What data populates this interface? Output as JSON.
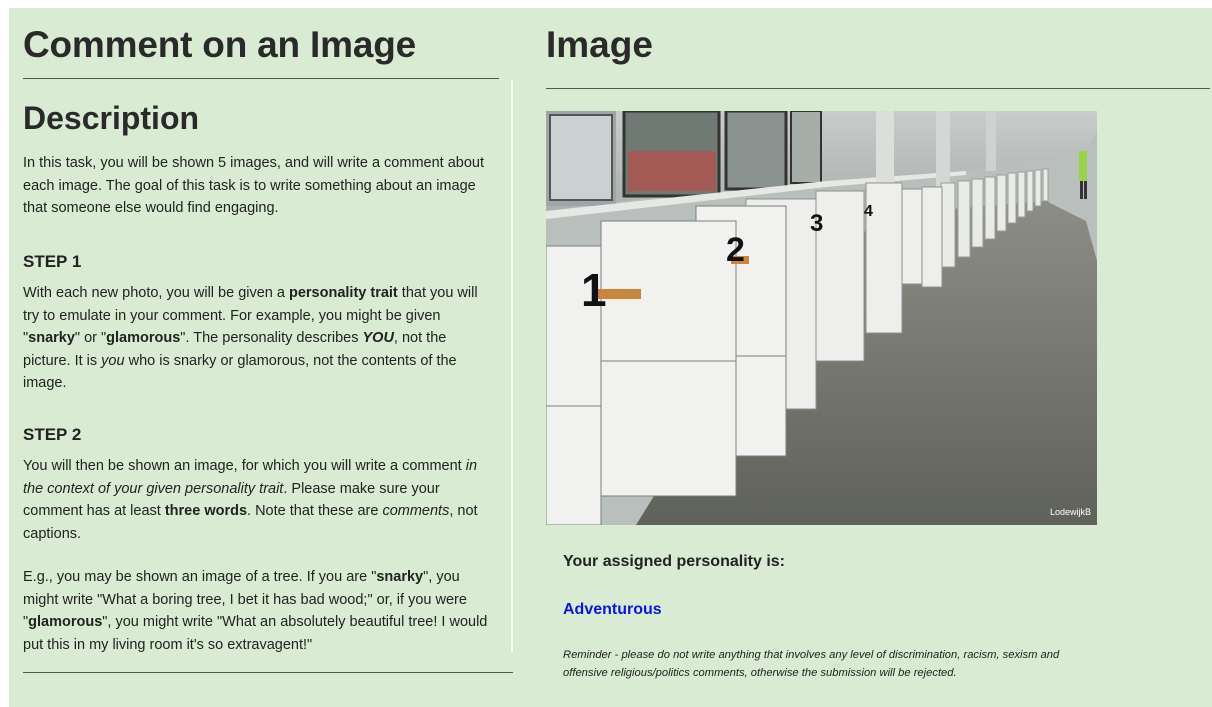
{
  "left": {
    "title": "Comment on an Image",
    "description_heading": "Description",
    "intro": "In this task, you will be shown 5 images, and will write a comment about each image. The goal of this task is to write something about an image that someone else would find engaging.",
    "step1": {
      "heading": "STEP 1",
      "t1": "With each new photo, you will be given a ",
      "b1": "personality trait",
      "t2": " that you will try to emulate in your comment. For example, you might be given \"",
      "b2": "snarky",
      "t3": "\" or \"",
      "b3": "glamorous",
      "t4": "\". The personality describes ",
      "bi1": "YOU",
      "t5": ", not the picture. It is ",
      "i1": "you",
      "t6": " who is snarky or glamorous, not the contents of the image."
    },
    "step2": {
      "heading": "STEP 2",
      "t1": "You will then be shown an image, for which you will write a comment ",
      "i1": "in the context of your given personality trait",
      "t2": ". Please make sure your comment has at least ",
      "b1": "three words",
      "t3": ". Note that these are ",
      "i2": "comments",
      "t4": ", not captions."
    },
    "example": {
      "t1": "E.g., you may be shown an image of a tree. If you are \"",
      "b1": "snarky",
      "t2": "\", you might write \"What a boring tree, I bet it has bad wood;\" or, if you were \"",
      "b2": "glamorous",
      "t3": "\", you might write \"What an absolutely beautiful tree! I would put this in my living room it's so extravagent!\""
    }
  },
  "right": {
    "title": "Image",
    "photo_credit": "LodewijkB",
    "kiosk_numbers": [
      "1",
      "2",
      "3",
      "4"
    ],
    "assigned_label": "Your assigned personality is:",
    "personality": "Adventurous",
    "reminder": "Reminder - please do not write anything that involves any level of discrimination, racism, sexism and offensive religious/politics comments, otherwise the submission will be rejected."
  },
  "colors": {
    "background": "#d9ebd2",
    "personality": "#0a14e6"
  }
}
